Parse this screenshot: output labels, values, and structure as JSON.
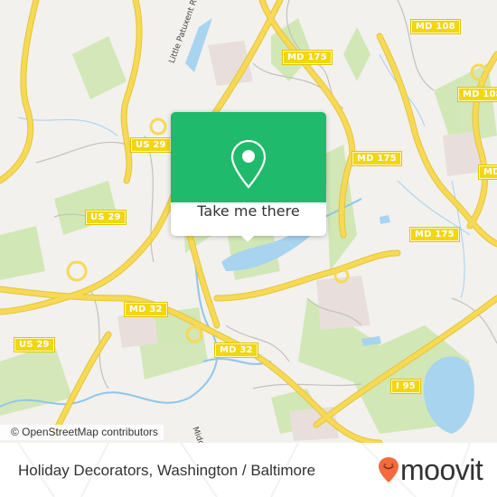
{
  "map": {
    "road_shields": [
      {
        "label": "MD 108"
      },
      {
        "label": "MD 175"
      },
      {
        "label": "MD 108"
      },
      {
        "label": "MD 175"
      },
      {
        "label": "MD 175"
      },
      {
        "label": "MD 175"
      },
      {
        "label": "US 29"
      },
      {
        "label": "US 29"
      },
      {
        "label": "MD 32"
      },
      {
        "label": "MD 32"
      },
      {
        "label": "US 29"
      },
      {
        "label": "I 95"
      },
      {
        "label": "MD"
      }
    ],
    "road_names": [
      {
        "label": "Little Patuxent R"
      },
      {
        "label": "Midd"
      }
    ],
    "attribution": "© OpenStreetMap contributors",
    "colors": {
      "land": "#f2f1ee",
      "park": "#c9e3a8",
      "water": "#a8d4ef",
      "highway": "#f6d955",
      "minor_road": "#b9b6b0"
    }
  },
  "popup": {
    "action_label": "Take me there",
    "icon": "map-pin-icon",
    "accent_color": "#1fba6b"
  },
  "footer": {
    "title": "Holiday Decorators, Washington / Baltimore",
    "brand": "moovit",
    "brand_icon": "moovit-pin-icon",
    "brand_color": "#f26a3d"
  }
}
